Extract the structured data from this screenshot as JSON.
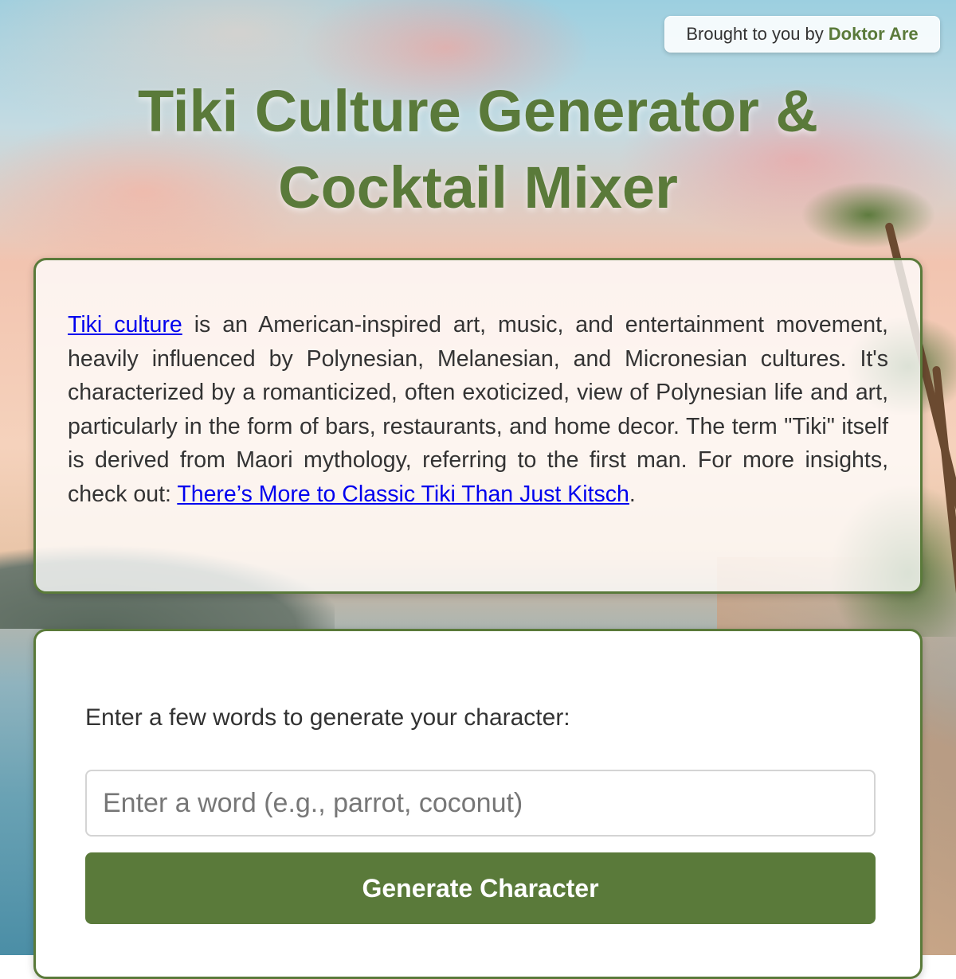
{
  "badge": {
    "prefix": "Brought to you by",
    "author": "Doktor Are"
  },
  "page": {
    "title": "Tiki Culture Generator & Cocktail Mixer"
  },
  "intro": {
    "link1_text": "Tiki culture",
    "text1": " is an American-inspired art, music, and entertainment movement, heavily influenced by Polynesian, Melanesian, and Micronesian cultures. It's characterized by a romanticized, often exoticized, view of Polynesian life and art, particularly in the form of bars, restaurants, and home decor. The term \"Tiki\" itself is derived from Maori mythology, referring to the first man. For more insights, check out: ",
    "link2_text": "There’s More to Classic Tiki Than Just Kitsch",
    "text2": "."
  },
  "form": {
    "prompt": "Enter a few words to generate your character:",
    "input_placeholder": "Enter a word (e.g., parrot, coconut)",
    "input_value": "",
    "button_label": "Generate Character"
  },
  "colors": {
    "accent": "#5a7a3a",
    "link": "#0000ee"
  }
}
